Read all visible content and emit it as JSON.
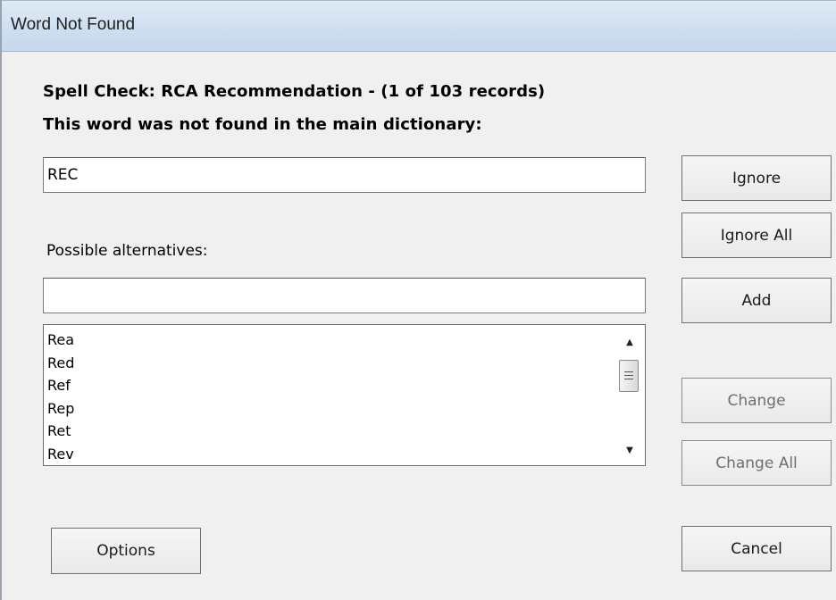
{
  "window": {
    "title": "Word Not Found"
  },
  "header": {
    "spellcheck_line": "Spell Check: RCA Recommendation - (1 of 103 records)",
    "not_found_line": "This word was not found in the main dictionary:"
  },
  "word": {
    "value": "REC"
  },
  "alternatives": {
    "label": "Possible alternatives:",
    "input_value": "",
    "items": [
      "Rea",
      "Red",
      "Ref",
      "Rep",
      "Ret",
      "Rev"
    ]
  },
  "buttons": {
    "ignore": "Ignore",
    "ignore_all": "Ignore All",
    "add": "Add",
    "change": "Change",
    "change_all": "Change All",
    "cancel": "Cancel",
    "options": "Options"
  },
  "icons": {
    "scroll_up": "scroll-up-arrow-icon",
    "scroll_down": "scroll-down-arrow-icon"
  }
}
